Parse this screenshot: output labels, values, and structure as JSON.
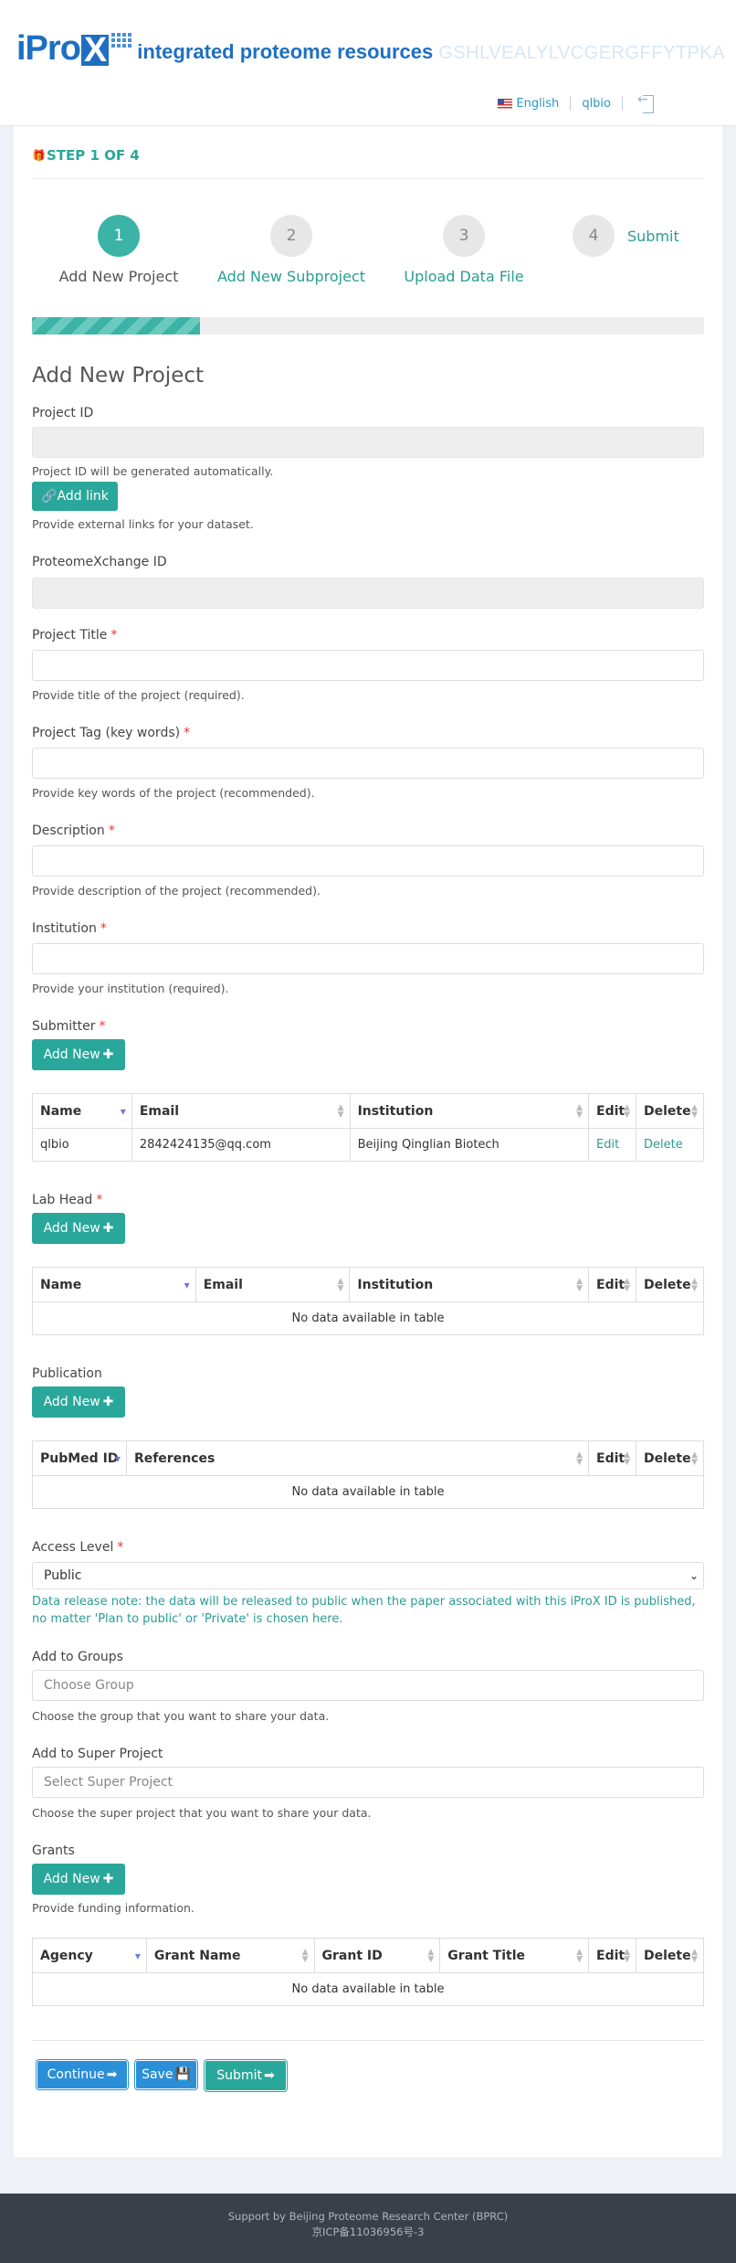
{
  "header": {
    "logo_main": "iPro",
    "logo_x": "X",
    "logo_tagline": "integrated proteome resources",
    "logo_sequence": "GSHLVEALYLVCGERGFFYTPKA",
    "language": "English",
    "username": "qlbio"
  },
  "wizard": {
    "step_title": "STEP 1 OF 4",
    "progress_fraction": 0.25,
    "steps": [
      {
        "number": "1",
        "label": "Add New Project",
        "active": true
      },
      {
        "number": "2",
        "label": "Add New Subproject",
        "active": false
      },
      {
        "number": "3",
        "label": "Upload Data File",
        "active": false
      },
      {
        "number": "4",
        "label": "Submit",
        "active": false
      }
    ]
  },
  "form": {
    "title": "Add New Project",
    "project_id": {
      "label": "Project ID",
      "value": "",
      "help": "Project ID will be generated automatically."
    },
    "add_link": {
      "label": "Add link",
      "help": "Provide external links for your dataset."
    },
    "px_id": {
      "label": "ProteomeXchange ID",
      "value": ""
    },
    "project_title": {
      "label": "Project Title",
      "value": "",
      "help": "Provide title of the project (required)."
    },
    "project_tag": {
      "label": "Project Tag (key words)",
      "value": "",
      "help": "Provide key words of the project (recommended)."
    },
    "description": {
      "label": "Description",
      "value": "",
      "help": "Provide description of the project (recommended)."
    },
    "institution": {
      "label": "Institution",
      "value": "",
      "help": "Provide your institution (required)."
    },
    "submitter": {
      "label": "Submitter",
      "add_new": "Add New",
      "columns": [
        "Name",
        "Email",
        "Institution",
        "Edit",
        "Delete"
      ],
      "rows": [
        {
          "name": "qlbio",
          "email": "2842424135@qq.com",
          "institution": "Beijing Qinglian Biotech",
          "edit": "Edit",
          "delete": "Delete"
        }
      ]
    },
    "lab_head": {
      "label": "Lab Head",
      "add_new": "Add New",
      "columns": [
        "Name",
        "Email",
        "Institution",
        "Edit",
        "Delete"
      ],
      "empty": "No data available in table"
    },
    "publication": {
      "label": "Publication",
      "add_new": "Add New",
      "columns": [
        "PubMed ID",
        "References",
        "Edit",
        "Delete"
      ],
      "empty": "No data available in table"
    },
    "access_level": {
      "label": "Access Level",
      "selected": "Public",
      "note": "Data release note: the data will be released to public when the paper associated with this iProX ID is published, no matter 'Plan to public' or 'Private' is chosen here."
    },
    "groups": {
      "label": "Add to Groups",
      "placeholder": "Choose Group",
      "help": "Choose the group that you want to share your data."
    },
    "super_project": {
      "label": "Add to Super Project",
      "placeholder": "Select Super Project",
      "help": "Choose the super project that you want to share your data."
    },
    "grants": {
      "label": "Grants",
      "add_new": "Add New",
      "help": "Provide funding information.",
      "columns": [
        "Agency",
        "Grant Name",
        "Grant ID",
        "Grant Title",
        "Edit",
        "Delete"
      ],
      "empty": "No data available in table"
    },
    "actions": {
      "continue": "Continue",
      "save": "Save",
      "submit": "Submit"
    }
  },
  "footer": {
    "line1": "Support by Beijing Proteome Research Center (BPRC)",
    "line2": "京ICP备11036956号-3"
  },
  "colors": {
    "accent": "#2aa79b",
    "primary": "#2b8fd8",
    "brand": "#1e6fc2",
    "required": "#e33333"
  }
}
